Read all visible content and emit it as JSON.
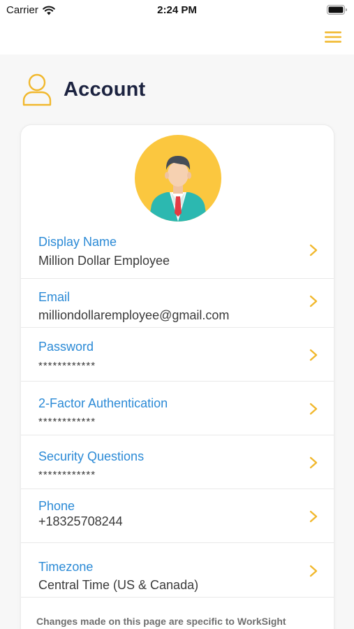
{
  "status_bar": {
    "carrier": "Carrier",
    "time": "2:24 PM",
    "wifi_icon": "wifi-icon",
    "battery_icon": "battery-icon"
  },
  "nav": {
    "menu_icon": "hamburger-menu-icon"
  },
  "header": {
    "title": "Account",
    "icon": "user-outline-icon"
  },
  "profile": {
    "avatar_icon": "employee-avatar-icon"
  },
  "rows": [
    {
      "label": "Display Name",
      "value": "Million Dollar Employee"
    },
    {
      "label": "Email",
      "value": "milliondollaremployee@gmail.com"
    },
    {
      "label": "Password",
      "value": "************"
    },
    {
      "label": "2-Factor Authentication",
      "value": "************"
    },
    {
      "label": "Security Questions",
      "value": "************"
    },
    {
      "label": "Phone",
      "value": "+18325708244"
    },
    {
      "label": "Timezone",
      "value": "Central Time (US & Canada)"
    }
  ],
  "footer_note": "Changes made on this page are specific to WorkSight",
  "colors": {
    "accent": "#f1b82d",
    "label_blue": "#2b8ad6",
    "title": "#1c2340",
    "avatar_bg": "#fbc73f",
    "background": "#f7f7f7"
  }
}
